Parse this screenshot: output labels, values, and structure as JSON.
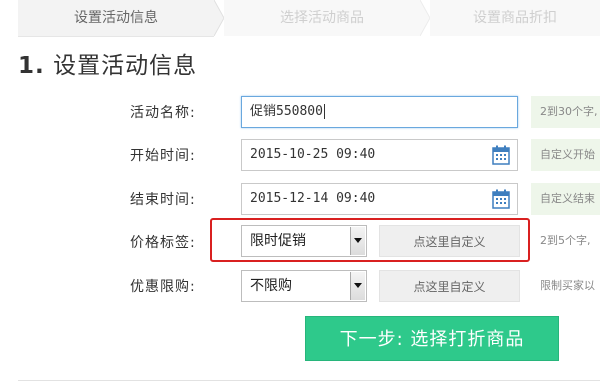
{
  "steps": [
    {
      "label": "设置活动信息",
      "state": "active"
    },
    {
      "label": "选择活动商品",
      "state": "inactive"
    },
    {
      "label": "设置商品折扣",
      "state": "inactive"
    }
  ],
  "section": {
    "number": "1.",
    "title": "设置活动信息"
  },
  "form": {
    "name": {
      "label": "活动名称:",
      "value": "促销550800",
      "hint": "2到30个字,"
    },
    "start": {
      "label": "开始时间:",
      "value": "2015-10-25 09:40",
      "hint": "自定义开始"
    },
    "end": {
      "label": "结束时间:",
      "value": "2015-12-14 09:40",
      "hint": "自定义结束"
    },
    "price_tag": {
      "label": "价格标签:",
      "selected": "限时促销",
      "custom": "点这里自定义",
      "hint": "2到5个字,"
    },
    "limit": {
      "label": "优惠限购:",
      "selected": "不限购",
      "custom": "点这里自定义",
      "hint": "限制买家以"
    }
  },
  "next_button": "下一步: 选择打折商品",
  "colors": {
    "accent": "#2ec98b",
    "highlight": "#d92020",
    "focus": "#6aa8de"
  },
  "icons": {
    "calendar": "calendar-icon",
    "dropdown": "chevron-down-icon"
  }
}
